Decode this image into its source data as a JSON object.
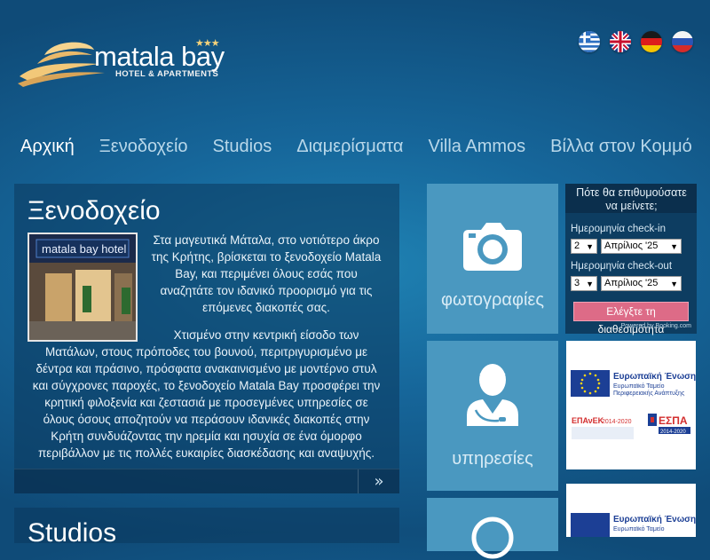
{
  "brand": {
    "name": "matala bay",
    "stars": "★★★",
    "tagline": "HOTEL & APARTMENTS"
  },
  "languages": [
    {
      "code": "el",
      "icon": "greek-flag-icon"
    },
    {
      "code": "en",
      "icon": "uk-flag-icon"
    },
    {
      "code": "de",
      "icon": "german-flag-icon"
    },
    {
      "code": "ru",
      "icon": "russian-flag-icon"
    }
  ],
  "nav": [
    {
      "label": "Αρχική"
    },
    {
      "label": "Ξενοδοχείο"
    },
    {
      "label": "Studios"
    },
    {
      "label": "Διαμερίσματα"
    },
    {
      "label": "Villa Ammos"
    },
    {
      "label": "Βίλλα στον Κομμό"
    }
  ],
  "main": {
    "title": "Ξενοδοχείο",
    "image_sign": "matala bay hotel",
    "paragraph1": "Στα μαγευτικά Μάταλα, στο νοτιότερο άκρο της Κρήτης, βρίσκεται το ξενοδοχείο Matala Bay, και περιμένει όλους εσάς που αναζητάτε τον ιδανικό προορισμό για τις επόμενες διακοπές σας.",
    "paragraph2": "Χτισμένο στην κεντρική είσοδο των Ματάλων, στους πρόποδες του βουνού, περιτριγυρισμένο με δέντρα και πράσινο, πρόσφατα ανακαινισμένο με μοντέρνο στυλ και σύγχρονες παροχές, το ξενοδοχείο Matala Bay προσφέρει την κρητική φιλοξενία και ζεστασιά με προσεγμένες υπηρεσίες σε όλους όσους αποζητούν να περάσουν ιδανικές διακοπές στην Κρήτη συνδυάζοντας την ηρεμία και ησυχία σε ένα όμορφο περιβάλλον με τις πολλές ευκαιρίες διασκέδασης και αναψυχής.",
    "more_icon": "double-chevron-right-icon",
    "more_glyph": "»"
  },
  "studios": {
    "title": "Studios"
  },
  "tiles": [
    {
      "label": "φωτογραφίες",
      "icon": "camera-icon"
    },
    {
      "label": "υπηρεσίες",
      "icon": "receptionist-icon"
    },
    {
      "label": "",
      "icon": "info-icon"
    }
  ],
  "booking": {
    "question": "Πότε θα επιθυμούσατε να μείνετε;",
    "checkin_label": "Ημερομηνία check-in",
    "checkin_day": "2",
    "checkin_month": "Απρίλιος '25",
    "checkout_label": "Ημερομηνία check-out",
    "checkout_day": "3",
    "checkout_month": "Απρίλιος '25",
    "button": "Ελέγξτε τη διαθεσιμότητα",
    "powered": "Powered by Booking.com"
  },
  "eu_banner": {
    "union": "Ευρωπαϊκή Ένωση",
    "fund1": "Ευρωπαϊκό Ταμείο",
    "fund2": "Περιφερειακής Ανάπτυξης",
    "epanek": "ΕΠΑνΕΚ",
    "epanek_years": "2014-2020",
    "espa": "ΕΣΠΑ",
    "espa_years": "2014-2020"
  },
  "colors": {
    "accent": "#dd6b87",
    "tile": "#4a98c0",
    "panel": "#0d3d61"
  }
}
